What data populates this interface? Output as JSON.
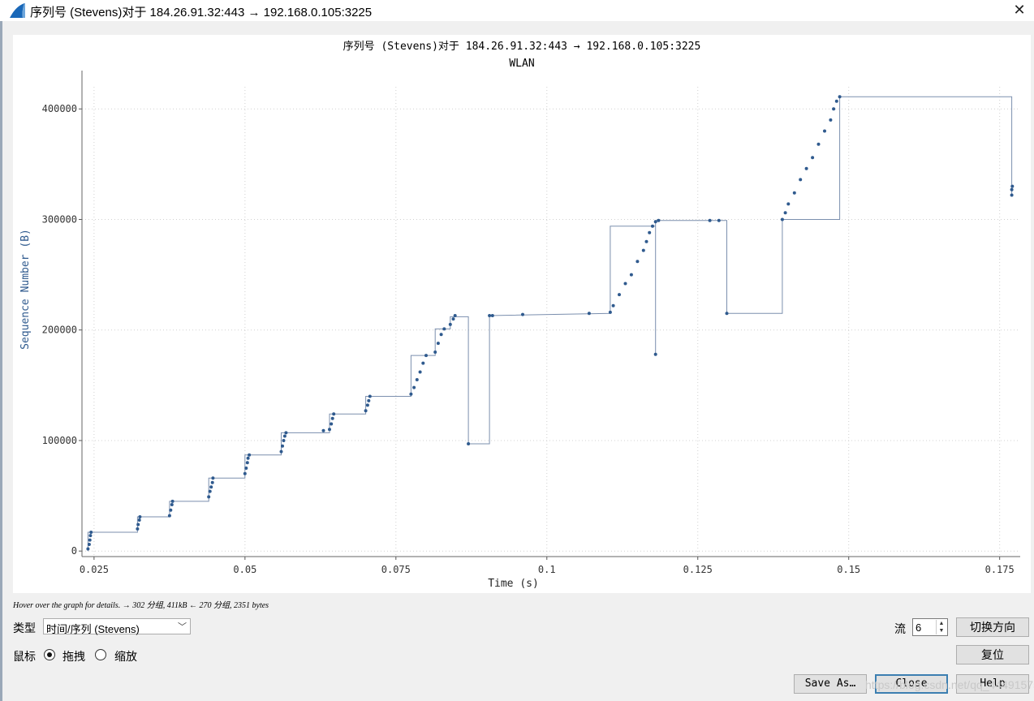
{
  "window": {
    "title": "序列号 (Stevens)对于 184.26.91.32:443 → 192.168.0.105:3225"
  },
  "plot": {
    "title": "序列号 (Stevens)对于 184.26.91.32:443 → 192.168.0.105:3225",
    "subtitle": "WLAN"
  },
  "chart_data": {
    "type": "scatter",
    "title": "序列号 (Stevens)对于 184.26.91.32:443 → 192.168.0.105:3225",
    "subtitle": "WLAN",
    "xlabel": "Time (s)",
    "ylabel": "Sequence Number (B)",
    "xlim": [
      0.023,
      0.178
    ],
    "ylim": [
      -5000,
      420000
    ],
    "x_ticks": [
      0.025,
      0.05,
      0.075,
      0.1,
      0.125,
      0.15,
      0.175
    ],
    "x_tick_labels": [
      "0.025",
      "0.05",
      "0.075",
      "0.1",
      "0.125",
      "0.15",
      "0.175"
    ],
    "y_ticks": [
      0,
      100000,
      200000,
      300000,
      400000
    ],
    "y_tick_labels": [
      "0",
      "100000",
      "200000",
      "300000",
      "400000"
    ],
    "grid": true,
    "colors": {
      "series": "#2f5a8e",
      "line": "#7b8fae",
      "grid": "#d0d0d0",
      "axis_text": "#2f5a8e"
    },
    "series": [
      {
        "points": [
          [
            0.024,
            2000
          ],
          [
            0.0242,
            6000
          ],
          [
            0.0243,
            10000
          ],
          [
            0.0244,
            14000
          ],
          [
            0.0245,
            17000
          ],
          [
            0.0322,
            20000
          ],
          [
            0.0323,
            24000
          ],
          [
            0.0325,
            28000
          ],
          [
            0.0326,
            31000
          ],
          [
            0.0375,
            32000
          ],
          [
            0.0377,
            37000
          ],
          [
            0.0379,
            42000
          ],
          [
            0.038,
            45000
          ],
          [
            0.044,
            49000
          ],
          [
            0.0442,
            54000
          ],
          [
            0.0444,
            58000
          ],
          [
            0.0446,
            62000
          ],
          [
            0.0447,
            66000
          ],
          [
            0.05,
            70000
          ],
          [
            0.0502,
            75000
          ],
          [
            0.0504,
            80000
          ],
          [
            0.0505,
            84000
          ],
          [
            0.0507,
            87000
          ],
          [
            0.056,
            90000
          ],
          [
            0.0562,
            95000
          ],
          [
            0.0564,
            100000
          ],
          [
            0.0566,
            104000
          ],
          [
            0.0568,
            107000
          ],
          [
            0.063,
            109000
          ],
          [
            0.064,
            110000
          ],
          [
            0.0643,
            115000
          ],
          [
            0.0645,
            120000
          ],
          [
            0.0647,
            124000
          ],
          [
            0.07,
            127000
          ],
          [
            0.0703,
            132000
          ],
          [
            0.0705,
            136000
          ],
          [
            0.0707,
            140000
          ],
          [
            0.0775,
            142000
          ],
          [
            0.078,
            148000
          ],
          [
            0.0785,
            155000
          ],
          [
            0.079,
            162000
          ],
          [
            0.0795,
            170000
          ],
          [
            0.08,
            177000
          ],
          [
            0.0815,
            180000
          ],
          [
            0.082,
            188000
          ],
          [
            0.0825,
            196000
          ],
          [
            0.083,
            201000
          ],
          [
            0.084,
            205000
          ],
          [
            0.0845,
            210000
          ],
          [
            0.0848,
            213000
          ],
          [
            0.087,
            97000
          ],
          [
            0.0905,
            213000
          ],
          [
            0.091,
            213000
          ],
          [
            0.096,
            214000
          ],
          [
            0.107,
            215000
          ],
          [
            0.1105,
            216000
          ],
          [
            0.111,
            222000
          ],
          [
            0.112,
            232000
          ],
          [
            0.113,
            242000
          ],
          [
            0.114,
            250000
          ],
          [
            0.115,
            262000
          ],
          [
            0.116,
            272000
          ],
          [
            0.1165,
            280000
          ],
          [
            0.117,
            288000
          ],
          [
            0.1175,
            294000
          ],
          [
            0.118,
            178000
          ],
          [
            0.118,
            298000
          ],
          [
            0.1185,
            299000
          ],
          [
            0.127,
            299000
          ],
          [
            0.1285,
            299000
          ],
          [
            0.1298,
            215000
          ],
          [
            0.139,
            300000
          ],
          [
            0.1395,
            306000
          ],
          [
            0.14,
            314000
          ],
          [
            0.141,
            324000
          ],
          [
            0.142,
            336000
          ],
          [
            0.143,
            346000
          ],
          [
            0.144,
            356000
          ],
          [
            0.145,
            368000
          ],
          [
            0.146,
            380000
          ],
          [
            0.147,
            390000
          ],
          [
            0.1475,
            400000
          ],
          [
            0.148,
            407000
          ],
          [
            0.1485,
            411000
          ],
          [
            0.177,
            322000
          ],
          [
            0.177,
            327000
          ],
          [
            0.1771,
            330000
          ]
        ],
        "connector": [
          [
            0.024,
            0
          ],
          [
            0.024,
            17000
          ],
          [
            0.0322,
            17000
          ],
          [
            0.0322,
            31000
          ],
          [
            0.0375,
            31000
          ],
          [
            0.0375,
            45000
          ],
          [
            0.044,
            45000
          ],
          [
            0.044,
            66000
          ],
          [
            0.05,
            66000
          ],
          [
            0.05,
            87000
          ],
          [
            0.056,
            87000
          ],
          [
            0.056,
            107000
          ],
          [
            0.064,
            107000
          ],
          [
            0.064,
            124000
          ],
          [
            0.07,
            124000
          ],
          [
            0.07,
            140000
          ],
          [
            0.0775,
            140000
          ],
          [
            0.0775,
            177000
          ],
          [
            0.0815,
            177000
          ],
          [
            0.0815,
            201000
          ],
          [
            0.084,
            201000
          ],
          [
            0.084,
            212000
          ],
          [
            0.087,
            212000
          ],
          [
            0.087,
            97000
          ],
          [
            0.0905,
            97000
          ],
          [
            0.0905,
            213000
          ],
          [
            0.1105,
            215000
          ],
          [
            0.1105,
            294000
          ],
          [
            0.118,
            294000
          ],
          [
            0.118,
            178000
          ],
          [
            0.118,
            299000
          ],
          [
            0.1298,
            299000
          ],
          [
            0.1298,
            215000
          ],
          [
            0.139,
            215000
          ],
          [
            0.139,
            300000
          ],
          [
            0.1485,
            300000
          ],
          [
            0.1485,
            411000
          ],
          [
            0.177,
            411000
          ],
          [
            0.177,
            322000
          ]
        ]
      }
    ]
  },
  "status": {
    "hint": "Hover over the graph for details. → 302 分组, 411kB ← 270 分组, 2351 bytes"
  },
  "controls": {
    "type_label": "类型",
    "type_value": "时间/序列 (Stevens)",
    "mouse_label": "鼠标",
    "drag_label": "拖拽",
    "zoom_label": "缩放",
    "drag_checked": true,
    "stream_label": "流",
    "stream_value": "6",
    "switch_direction": "切换方向",
    "reset": "复位",
    "save_as": "Save As…",
    "close": "Close",
    "help": "Help"
  },
  "watermark": "https://blog.csdn.net/qq_44491575"
}
